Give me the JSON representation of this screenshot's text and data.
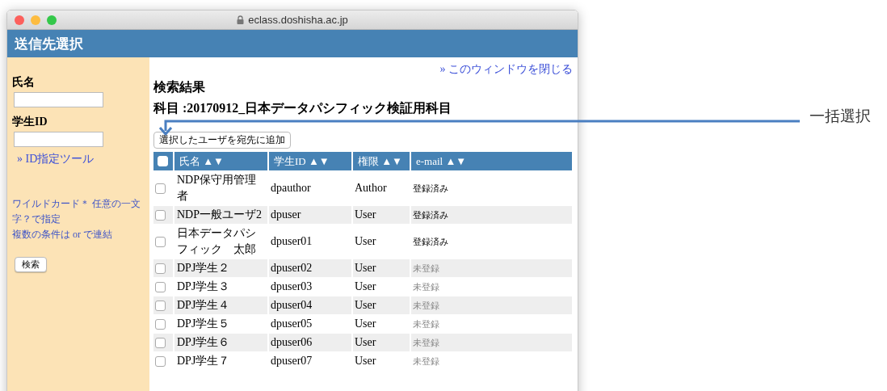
{
  "window": {
    "url": "eclass.doshisha.ac.jp"
  },
  "header": {
    "title": "送信先選択"
  },
  "sidebar": {
    "fields": [
      {
        "label": "氏名"
      },
      {
        "label": "学生ID"
      }
    ],
    "tool_link": "» ID指定ツール",
    "hints": [
      "ワイルドカード＊ 任意の一文字？で指定",
      "複数の条件は or で連結"
    ],
    "search_button": "検索"
  },
  "main": {
    "close_link": "» このウィンドウを閉じる",
    "heading": "検索結果",
    "subject": "科目 :20170912_日本データパシフィック検証用科目",
    "add_button": "選択したユーザを宛先に追加",
    "table": {
      "select_all_checked": false,
      "columns": [
        "氏名 ▲▼",
        "学生ID ▲▼",
        "権限 ▲▼",
        "e-mail ▲▼"
      ],
      "rows": [
        {
          "checked": false,
          "name": "NDP保守用管理者",
          "id": "dpauthor",
          "role": "Author",
          "email": "登録済み",
          "registered": true
        },
        {
          "checked": false,
          "name": "NDP一般ユーザ2",
          "id": "dpuser",
          "role": "User",
          "email": "登録済み",
          "registered": true
        },
        {
          "checked": false,
          "name": "日本データパシフィック　太郎",
          "id": "dpuser01",
          "role": "User",
          "email": "登録済み",
          "registered": true
        },
        {
          "checked": false,
          "name": "DPJ学生２",
          "id": "dpuser02",
          "role": "User",
          "email": "未登録",
          "registered": false
        },
        {
          "checked": false,
          "name": "DPJ学生３",
          "id": "dpuser03",
          "role": "User",
          "email": "未登録",
          "registered": false
        },
        {
          "checked": false,
          "name": "DPJ学生４",
          "id": "dpuser04",
          "role": "User",
          "email": "未登録",
          "registered": false
        },
        {
          "checked": false,
          "name": "DPJ学生５",
          "id": "dpuser05",
          "role": "User",
          "email": "未登録",
          "registered": false
        },
        {
          "checked": false,
          "name": "DPJ学生６",
          "id": "dpuser06",
          "role": "User",
          "email": "未登録",
          "registered": false
        },
        {
          "checked": false,
          "name": "DPJ学生７",
          "id": "dpuser07",
          "role": "User",
          "email": "未登録",
          "registered": false
        }
      ]
    }
  },
  "annotation": {
    "label": "一括選択"
  }
}
